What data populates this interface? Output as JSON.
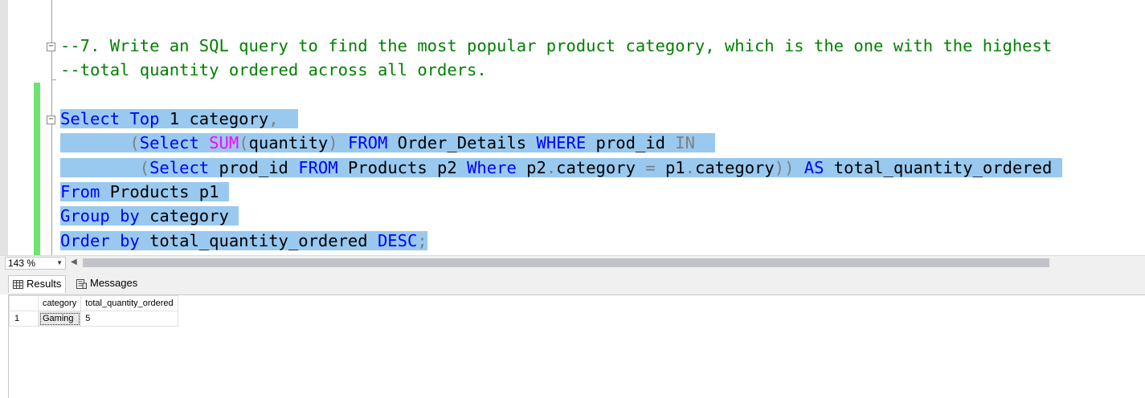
{
  "editor": {
    "lines": {
      "l1": {
        "t1": "--7. Write an SQL query to find the most popular product category, which is the one with the highest"
      },
      "l2": {
        "t1": "--total quantity ordered across all orders."
      },
      "l3": {
        "t1": "Select",
        "t2": " ",
        "t3": "Top",
        "t4": " 1 category",
        "t5": ","
      },
      "l4": {
        "t1": "       ",
        "t2": "(",
        "t3": "Select",
        "t4": " ",
        "t5": "SUM",
        "t6": "(",
        "t7": "quantity",
        "t8": ")",
        "t9": " ",
        "t10": "FROM",
        "t11": " Order_Details ",
        "t12": "WHERE",
        "t13": " prod_id ",
        "t14": "IN"
      },
      "l5": {
        "t1": "        ",
        "t2": "(",
        "t3": "Select",
        "t4": " prod_id ",
        "t5": "FROM",
        "t6": " Products p2 ",
        "t7": "Where",
        "t8": " p2",
        "t9": ".",
        "t10": "category ",
        "t11": "=",
        "t12": " p1",
        "t13": ".",
        "t14": "category",
        "t15": "))",
        "t16": " ",
        "t17": "AS",
        "t18": " total_quantity_ordered"
      },
      "l6": {
        "t1": "From",
        "t2": " Products p1"
      },
      "l7": {
        "t1": "Group",
        "t2": " ",
        "t3": "by",
        "t4": " category"
      },
      "l8": {
        "t1": "Order",
        "t2": " ",
        "t3": "by",
        "t4": " total_quantity_ordered ",
        "t5": "DESC",
        "t6": ";"
      }
    }
  },
  "zoom": {
    "level": "143 %"
  },
  "tabs": {
    "results": "Results",
    "messages": "Messages"
  },
  "results": {
    "columns": [
      "category",
      "total_quantity_ordered"
    ],
    "rows": [
      {
        "num": "1",
        "category": "Gaming",
        "total": "5"
      }
    ]
  },
  "colors": {
    "selection": "#99c9ef",
    "comment": "#008000",
    "keyword": "#0000ff",
    "function": "#ff00ff",
    "operator": "#808080",
    "change_bar": "#6ee46e"
  },
  "icons": {
    "results_tab": "grid-icon",
    "messages_tab": "messages-icon"
  }
}
